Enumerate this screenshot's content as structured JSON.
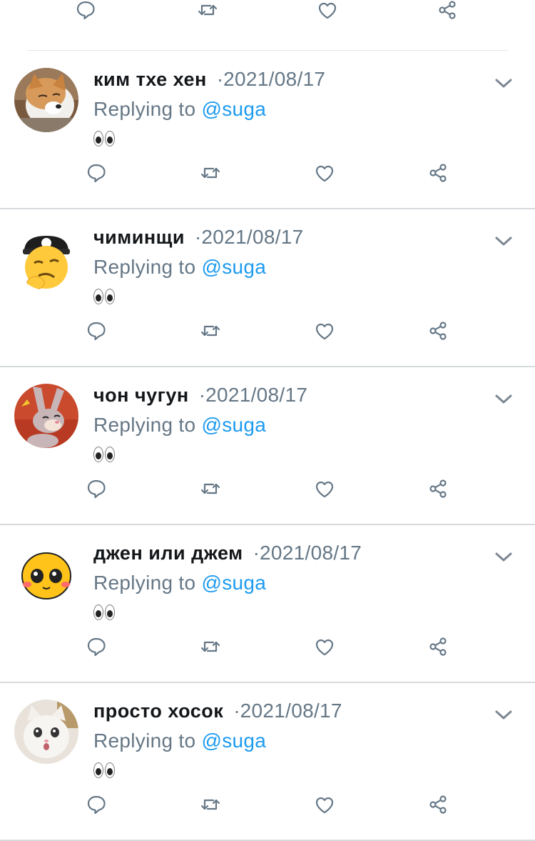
{
  "reply_prefix": "Replying to",
  "colors": {
    "link": "#1d9bf0",
    "muted": "#657786",
    "name": "#14171a",
    "divider": "#d7dadd"
  },
  "icons": {
    "reply": "reply-icon",
    "retweet": "retweet-icon",
    "like": "heart-icon",
    "share": "share-icon",
    "menu": "chevron-down-icon"
  },
  "tweets": [
    {
      "name": "ким тхе хен",
      "date": "2021/08/17",
      "handle": "@suga",
      "content": "👀",
      "avatar": "shiba-dog"
    },
    {
      "name": "чиминщи",
      "date": "2021/08/17",
      "handle": "@suga",
      "content": "👀",
      "avatar": "emoji-cap"
    },
    {
      "name": "чон чугун",
      "date": "2021/08/17",
      "handle": "@suga",
      "content": "👀",
      "avatar": "bunny-cartoon"
    },
    {
      "name": "джен или джем",
      "date": "2021/08/17",
      "handle": "@suga",
      "content": "👀",
      "avatar": "cute-emoji"
    },
    {
      "name": "просто хосок",
      "date": "2021/08/17",
      "handle": "@suga",
      "content": "👀",
      "avatar": "white-cat"
    }
  ]
}
